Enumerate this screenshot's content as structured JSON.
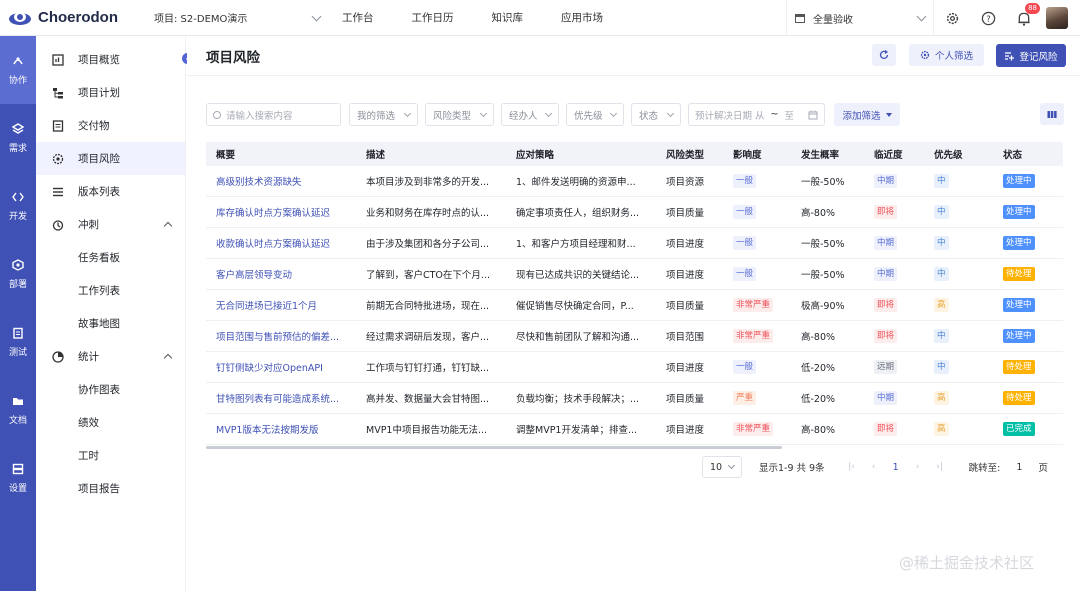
{
  "header": {
    "brand": "Choerodon",
    "project_select": "项目: S2-DEMO演示",
    "nav": [
      "工作台",
      "工作日历",
      "知识库",
      "应用市场"
    ],
    "scope_select": "全量验收",
    "notification_count": "88"
  },
  "rail": [
    {
      "label": "协作",
      "icon": "cooperate-icon"
    },
    {
      "label": "需求",
      "icon": "requirement-icon"
    },
    {
      "label": "开发",
      "icon": "code-icon"
    },
    {
      "label": "部署",
      "icon": "deploy-icon"
    },
    {
      "label": "测试",
      "icon": "test-icon"
    },
    {
      "label": "文档",
      "icon": "document-icon"
    },
    {
      "label": "设置",
      "icon": "settings-icon"
    }
  ],
  "sidebar": {
    "items": [
      {
        "label": "项目概览",
        "icon": "overview-icon"
      },
      {
        "label": "项目计划",
        "icon": "plan-icon"
      },
      {
        "label": "交付物",
        "icon": "deliverable-icon"
      },
      {
        "label": "项目风险",
        "icon": "risk-icon"
      },
      {
        "label": "版本列表",
        "icon": "version-list-icon"
      },
      {
        "label": "冲刺",
        "icon": "sprint-icon"
      },
      {
        "label": "任务看板"
      },
      {
        "label": "工作列表"
      },
      {
        "label": "故事地图"
      },
      {
        "label": "统计",
        "icon": "statistics-icon"
      },
      {
        "label": "协作图表"
      },
      {
        "label": "绩效"
      },
      {
        "label": "工时"
      },
      {
        "label": "项目报告"
      }
    ]
  },
  "page": {
    "title": "项目风险",
    "filter_button": "个人筛选",
    "create_button": "登记风险"
  },
  "filters": {
    "search_placeholder": "请输入搜索内容",
    "my_filter": "我的筛选",
    "risk_type": "风险类型",
    "handler": "经办人",
    "priority": "优先级",
    "status": "状态",
    "date_placeholder": "预计解决日期 从",
    "date_sep": "~",
    "date_to": "至",
    "add_filter": "添加筛选"
  },
  "table": {
    "headers": [
      "概要",
      "描述",
      "应对策略",
      "风险类型",
      "影响度",
      "发生概率",
      "临近度",
      "优先级",
      "状态"
    ],
    "rows": [
      {
        "summary": "高级别技术资源缺失",
        "desc": "本项目涉及到非常多的开发...",
        "strategy": "1、邮件发送明确的资源申...",
        "type": "项目资源",
        "impact": "一般",
        "prob": "一般-50%",
        "near": "中期",
        "priority": "中",
        "status": "处理中"
      },
      {
        "summary": "库存确认时点方案确认延迟",
        "desc": "业务和财务在库存时点的认...",
        "strategy": "确定事项责任人，组织财务...",
        "type": "项目质量",
        "impact": "一般",
        "prob": "高-80%",
        "near": "即将",
        "priority": "中",
        "status": "处理中"
      },
      {
        "summary": "收款确认时点方案确认延迟",
        "desc": "由于涉及集团和各分子公司...",
        "strategy": "1、和客户方项目经理和财...",
        "type": "项目进度",
        "impact": "一般",
        "prob": "一般-50%",
        "near": "中期",
        "priority": "中",
        "status": "处理中"
      },
      {
        "summary": "客户高层领导变动",
        "desc": "了解到，客户CTO在下个月...",
        "strategy": "现有已达成共识的关键结论...",
        "type": "项目进度",
        "impact": "一般",
        "prob": "一般-50%",
        "near": "中期",
        "priority": "中",
        "status": "待处理"
      },
      {
        "summary": "无合同进场已接近1个月",
        "desc": "前期无合同特批进场，现在...",
        "strategy": "催促销售尽快确定合同，P...",
        "type": "项目质量",
        "impact": "非常严重",
        "prob": "极高-90%",
        "near": "即将",
        "priority": "高",
        "status": "处理中"
      },
      {
        "summary": "项目范围与售前预估的偏差...",
        "desc": "经过需求调研后发现，客户...",
        "strategy": "尽快和售前团队了解和沟通...",
        "type": "项目范围",
        "impact": "非常严重",
        "prob": "高-80%",
        "near": "即将",
        "priority": "中",
        "status": "处理中"
      },
      {
        "summary": "钉钉侧缺少对应OpenAPI",
        "desc": "工作项与钉钉打通，钉钉缺...",
        "strategy": "",
        "type": "项目进度",
        "impact": "一般",
        "prob": "低-20%",
        "near": "远期",
        "priority": "中",
        "status": "待处理"
      },
      {
        "summary": "甘特图列表有可能造成系统...",
        "desc": "高并发、数据量大会甘特图...",
        "strategy": "负载均衡；技术手段解决；...",
        "type": "项目质量",
        "impact": "严重",
        "prob": "低-20%",
        "near": "中期",
        "priority": "高",
        "status": "待处理"
      },
      {
        "summary": "MVP1版本无法按期发版",
        "desc": "MVP1中项目报告功能无法...",
        "strategy": "调整MVP1开发清单；排查...",
        "type": "项目进度",
        "impact": "非常严重",
        "prob": "高-80%",
        "near": "即将",
        "priority": "高",
        "status": "已完成"
      }
    ]
  },
  "tag_colors": {
    "一般": {
      "fg": "#5b6fd6",
      "bg": "#eef0fb"
    },
    "非常严重": {
      "fg": "#f0535b",
      "bg": "#fdecec"
    },
    "严重": {
      "fg": "#f0805b",
      "bg": "#fdeee6"
    },
    "中期": {
      "fg": "#5b6fd6",
      "bg": "#eef0fb"
    },
    "即将": {
      "fg": "#f0535b",
      "bg": "#fdecec"
    },
    "远期": {
      "fg": "#6b7080",
      "bg": "#eef0f4"
    },
    "中": {
      "fg": "#4b84d6",
      "bg": "#e8f0fb"
    },
    "高": {
      "fg": "#e9a53a",
      "bg": "#fdf4e3"
    },
    "处理中": {
      "fg": "#ffffff",
      "bg": "#4d90fe"
    },
    "待处理": {
      "fg": "#ffffff",
      "bg": "#ffb100"
    },
    "已完成": {
      "fg": "#ffffff",
      "bg": "#00bfa5"
    }
  },
  "pagination": {
    "page_size": "10",
    "summary": "显示1-9 共 9条",
    "current": "1",
    "jump_label": "跳转至:",
    "jump_value": "1",
    "page_unit": "页"
  },
  "watermark": "@稀土掘金技术社区",
  "colors": {
    "primary": "#3f51b5"
  }
}
